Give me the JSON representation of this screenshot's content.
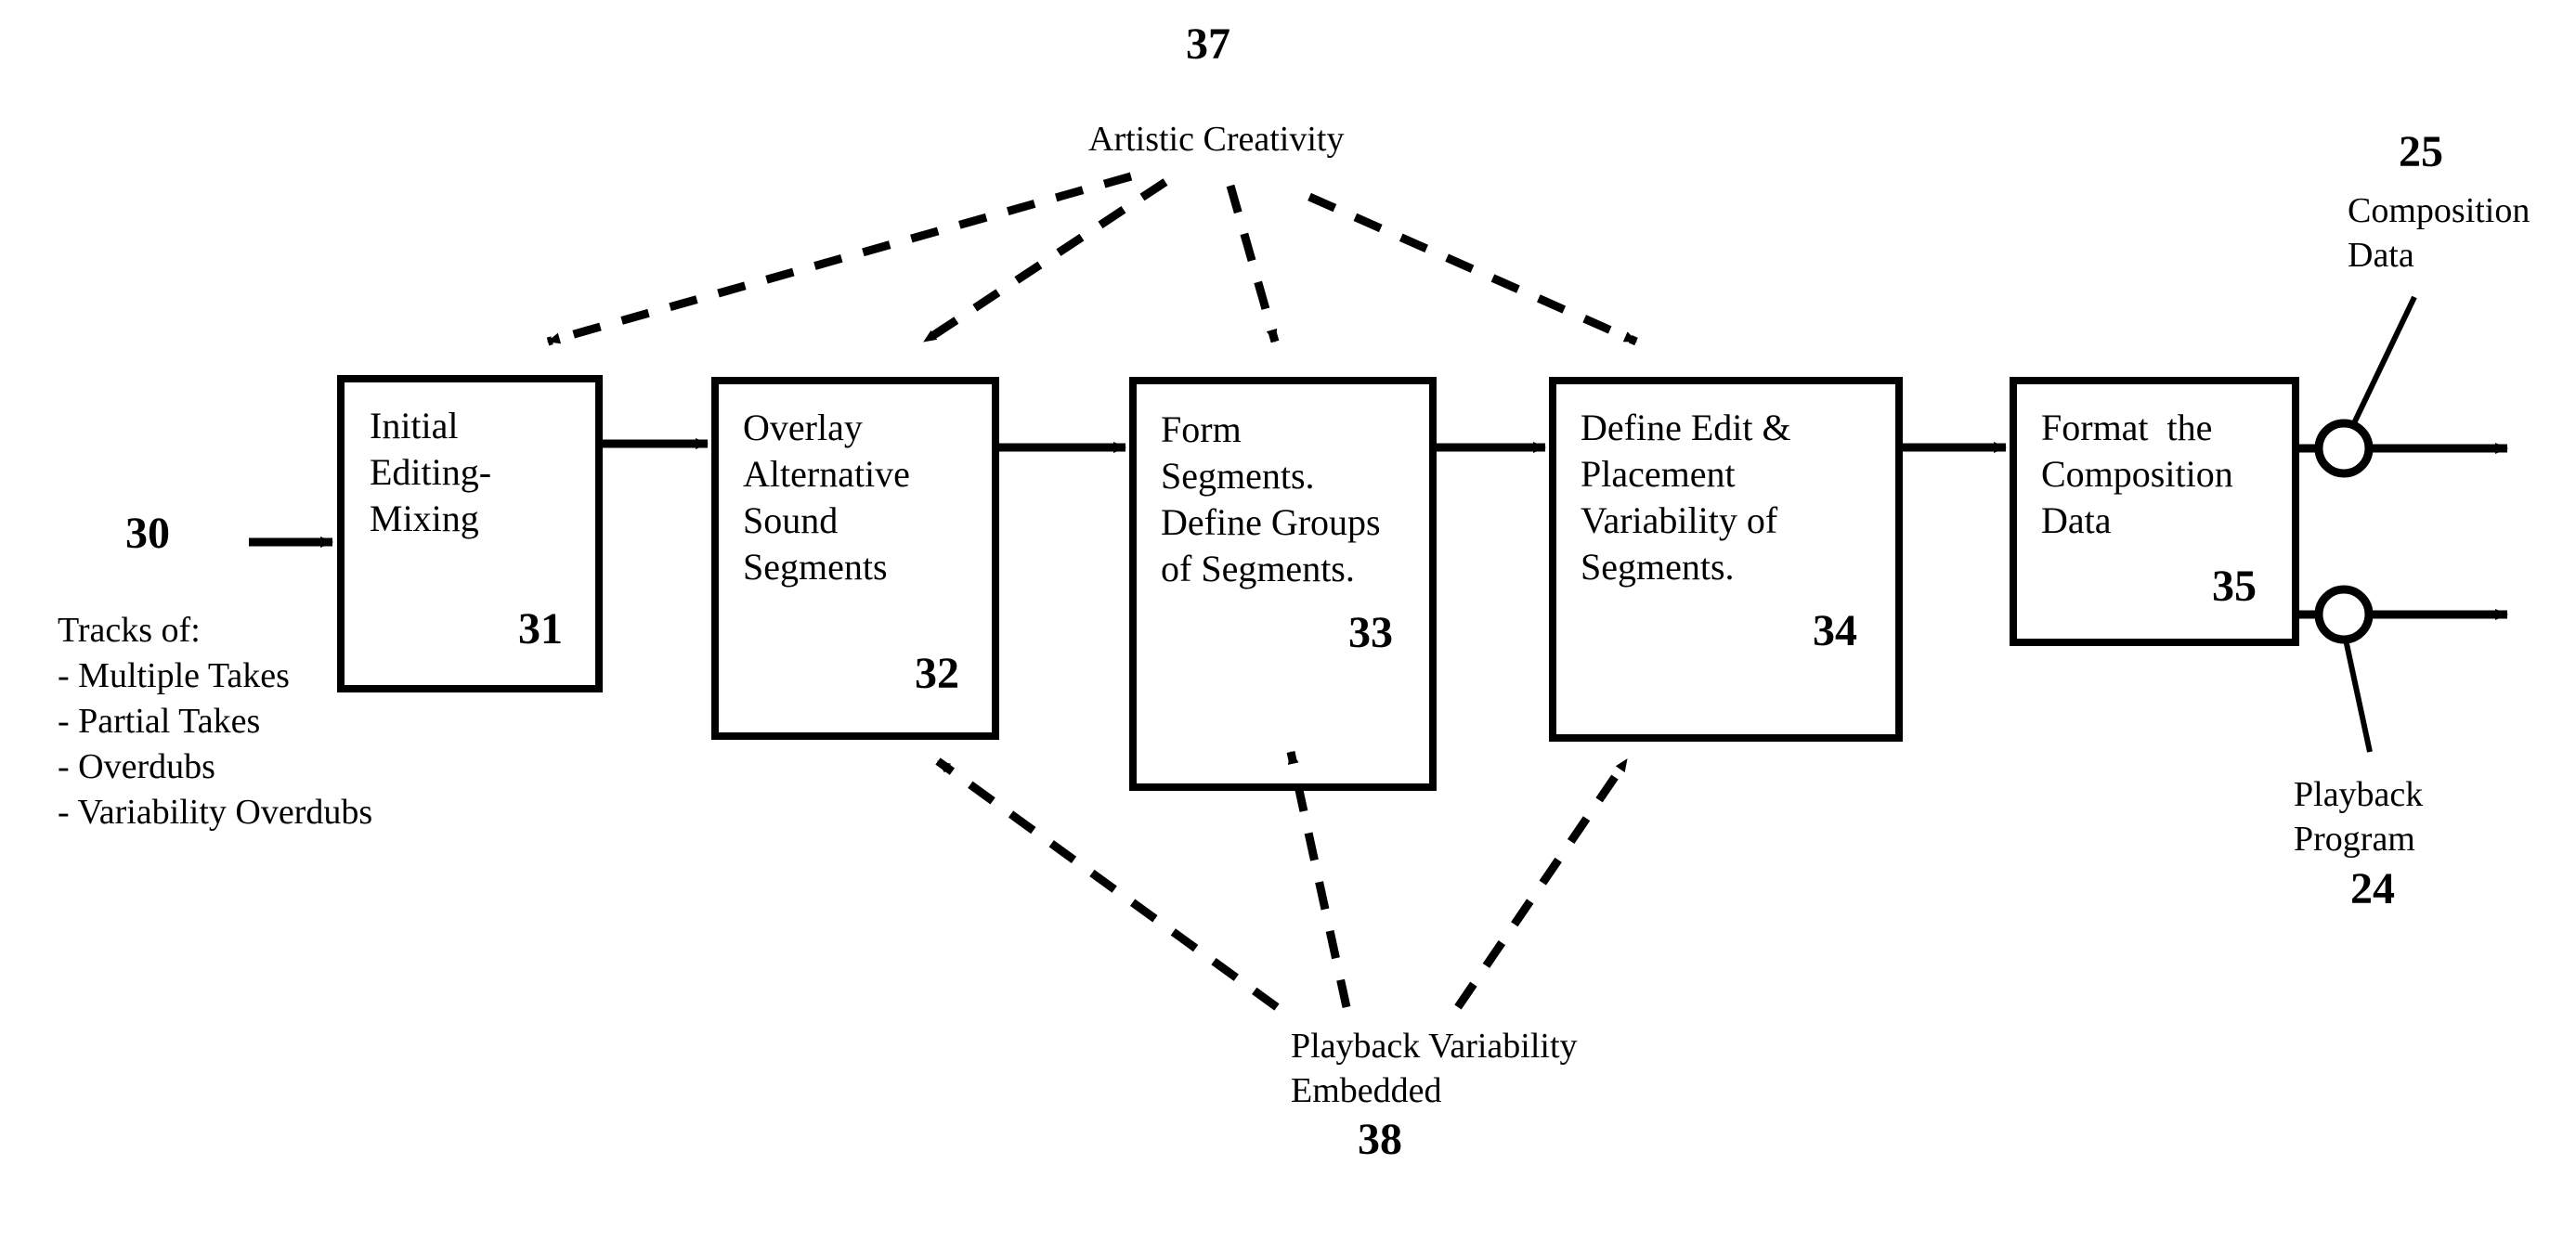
{
  "figure": {
    "type": "patent-flowchart",
    "background_color": "#ffffff",
    "line_color": "#000000"
  },
  "input": {
    "ref": "30",
    "heading": "Tracks of:",
    "items": [
      "- Multiple Takes",
      "- Partial Takes",
      "- Overdubs",
      "- Variability Overdubs"
    ]
  },
  "boxes": [
    {
      "ref": "31",
      "lines": [
        "Initial",
        "Editing-",
        "Mixing"
      ]
    },
    {
      "ref": "32",
      "lines": [
        "Overlay",
        "Alternative",
        "Sound",
        "Segments"
      ]
    },
    {
      "ref": "33",
      "lines": [
        "Form",
        "Segments.",
        "Define Groups",
        "of Segments."
      ]
    },
    {
      "ref": "34",
      "lines": [
        "Define Edit &",
        "Placement",
        "Variability of",
        "Segments."
      ]
    },
    {
      "ref": "35",
      "lines": [
        "Format  the",
        "Composition",
        "Data"
      ]
    }
  ],
  "top_annotation": {
    "ref": "37",
    "label": "Artistic Creativity"
  },
  "bottom_annotation": {
    "ref": "38",
    "lines": [
      "Playback Variability",
      "Embedded"
    ]
  },
  "outputs": [
    {
      "ref": "25",
      "lines": [
        "Composition",
        "Data"
      ]
    },
    {
      "ref": "24",
      "lines": [
        "Playback",
        "Program"
      ]
    }
  ]
}
